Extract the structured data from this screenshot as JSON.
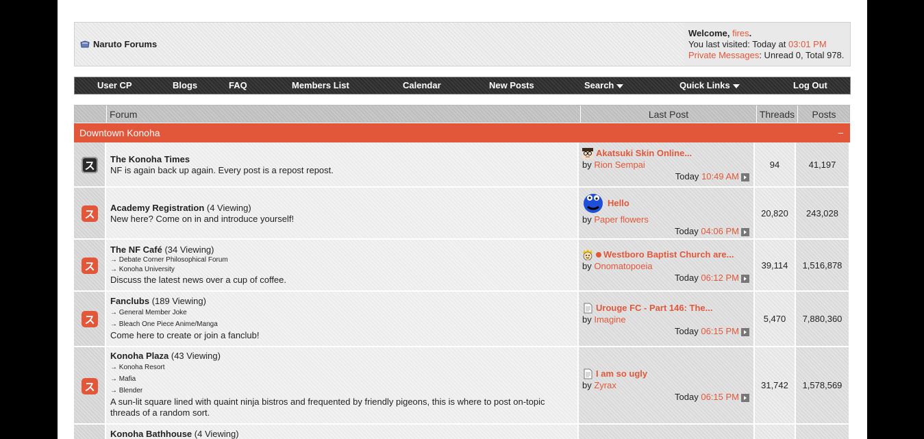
{
  "header": {
    "brand": "Naruto Forums",
    "welcome_prefix": "Welcome,",
    "username": "fires",
    "welcome_suffix": ".",
    "last_visited_prefix": "You last visited: Today at",
    "last_visited_time": "03:01 PM",
    "pm_label": "Private Messages",
    "pm_status": ": Unread 0, Total 978."
  },
  "nav": {
    "user_cp": "User CP",
    "blogs": "Blogs",
    "faq": "FAQ",
    "members": "Members List",
    "calendar": "Calendar",
    "new_posts": "New Posts",
    "search": "Search",
    "quick_links": "Quick Links",
    "logout": "Log Out"
  },
  "table": {
    "col_forum": "Forum",
    "col_last_post": "Last Post",
    "col_threads": "Threads",
    "col_posts": "Posts",
    "category": "Downtown Konoha",
    "collapse": "–"
  },
  "forums": [
    {
      "title": "The Konoha Times",
      "viewing": "",
      "subforums": [],
      "description": "NF is again back up again. Every post is a repost repost.",
      "last_post": {
        "title": "Akatsuki Skin Online...",
        "by": "by",
        "user": "Rion Sempai",
        "day": "Today",
        "time": "10:49 AM",
        "icon": "avatar-glasses-icon"
      },
      "threads": "94",
      "posts": "41,197"
    },
    {
      "title": "Academy Registration",
      "viewing": "(4 Viewing)",
      "subforums": [],
      "description": "New here? Come on in and introduce yourself!",
      "last_post": {
        "title": "Hello",
        "by": "by",
        "user": "Paper flowers",
        "day": "Today",
        "time": "04:06 PM",
        "icon": "avatar-cookie-monster-icon"
      },
      "threads": "20,820",
      "posts": "243,028"
    },
    {
      "title": "The NF Café",
      "viewing": "(34 Viewing)",
      "subforums": [
        "→ Debate Corner Philosophical Forum",
        "→ Konoha University"
      ],
      "description": "Discuss the latest news over a cup of coffee.",
      "last_post": {
        "title": "Westboro Baptist Church are...",
        "by": "by",
        "user": "Onomatopoeia",
        "day": "Today",
        "time": "06:12 PM",
        "icon": "avatar-naruto-icon"
      },
      "threads": "39,114",
      "posts": "1,516,878"
    },
    {
      "title": "Fanclubs",
      "viewing": "(189 Viewing)",
      "subforums": [
        "→ General Member Joke",
        "→ Bleach One Piece Anime/Manga"
      ],
      "description": "Come here to create or join a fanclub!",
      "last_post": {
        "title": "Urouge FC - Part 146: The...",
        "by": "by",
        "user": "Imagine",
        "day": "Today",
        "time": "06:15 PM",
        "icon": "document-icon"
      },
      "threads": "5,470",
      "posts": "7,880,360"
    },
    {
      "title": "Konoha Plaza",
      "viewing": "(43 Viewing)",
      "subforums": [
        "→ Konoha Resort",
        "→ Mafia",
        "→ Blender"
      ],
      "description": "A sun-lit square lined with quaint ninja bistros and frequented by friendly pigeons, this is where to post on-topic threads of a random sort.",
      "last_post": {
        "title": "I am so ugly",
        "by": "by",
        "user": "Zyrax",
        "day": "Today",
        "time": "06:15 PM",
        "icon": "document-icon"
      },
      "threads": "31,742",
      "posts": "1,578,569"
    },
    {
      "title": "Konoha Bathhouse",
      "viewing": "(4 Viewing)"
    }
  ],
  "colors": {
    "accent": "#e2573a",
    "nav_bg": "#333333"
  }
}
